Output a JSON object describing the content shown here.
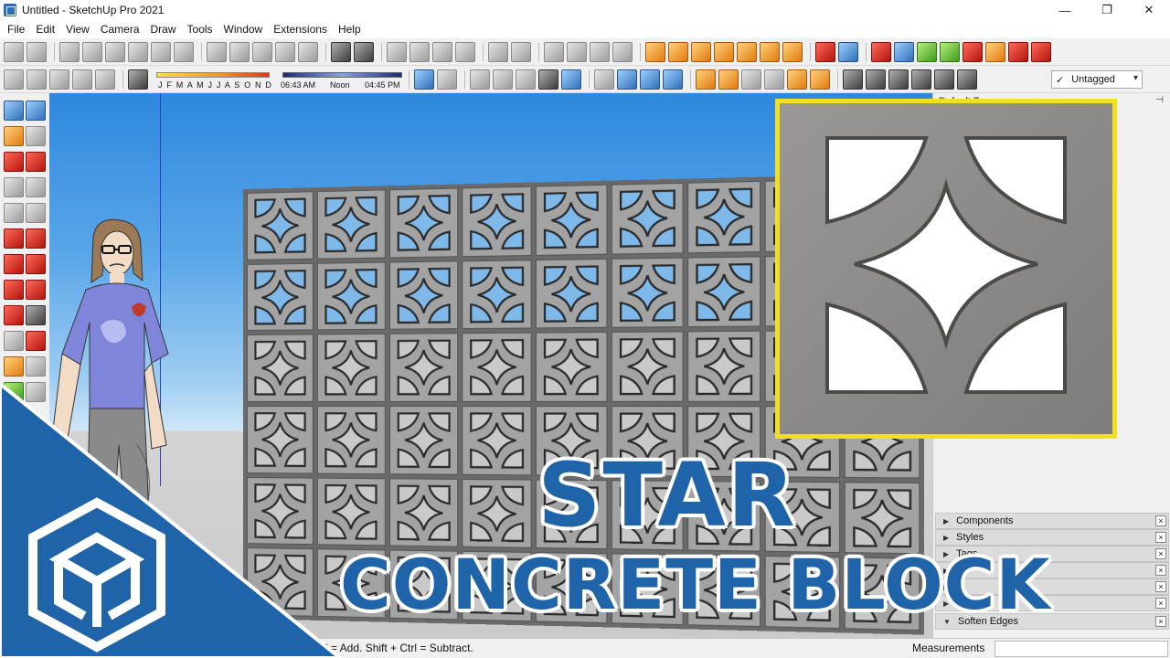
{
  "window": {
    "title": "Untitled - SketchUp Pro 2021",
    "minimize_glyph": "—",
    "restore_glyph": "❐",
    "close_glyph": "✕"
  },
  "menu": [
    "File",
    "Edit",
    "View",
    "Camera",
    "Draw",
    "Tools",
    "Window",
    "Extensions",
    "Help"
  ],
  "shadows": {
    "months_label": "J F M A M J J A S O N D",
    "time_start": "06:43 AM",
    "time_noon": "Noon",
    "time_end": "04:45 PM"
  },
  "tag_selector": {
    "check": "✓",
    "value": "Untagged",
    "dropdown": "▾"
  },
  "tray": {
    "header": "Default Tray",
    "pin": "⊣",
    "panels": [
      {
        "label": "Components",
        "arrow": "▶",
        "close": "×"
      },
      {
        "label": "Styles",
        "arrow": "▶",
        "close": "×"
      },
      {
        "label": "Tags",
        "arrow": "▶",
        "close": "×"
      },
      {
        "label": "",
        "arrow": "▶",
        "close": "×"
      },
      {
        "label": "",
        "arrow": "▶",
        "close": "×"
      },
      {
        "label": "",
        "arrow": "▶",
        "close": "×"
      },
      {
        "label": "Soften Edges",
        "arrow": "▼",
        "close": "×"
      }
    ]
  },
  "status": {
    "hint": "rl = Add. Shift + Ctrl = Subtract.",
    "measurements_label": "Measurements"
  },
  "headline": {
    "line1": "STAR",
    "line2": "CONCRETE BLOCK"
  },
  "colors": {
    "brand_blue": "#1f63a8",
    "highlight_yellow": "#f3df1d",
    "concrete_gray": "#8e8e8e"
  }
}
